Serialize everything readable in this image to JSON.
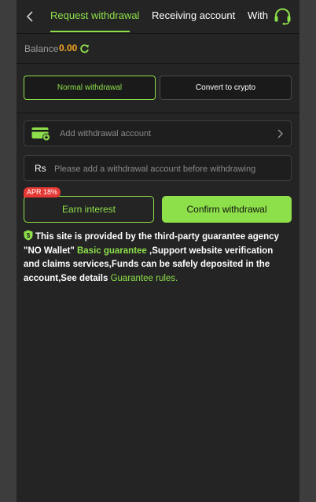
{
  "header": {
    "tabs": [
      {
        "label": "Request withdrawal",
        "active": true
      },
      {
        "label": "Receiving account",
        "active": false
      },
      {
        "label": "With",
        "active": false
      }
    ],
    "icons": {
      "back": "chevron-left-icon",
      "support": "headset-icon"
    }
  },
  "balance": {
    "label": "Balance",
    "value": "0.00",
    "icon": "refresh-icon"
  },
  "methods": {
    "normal": "Normal withdrawal",
    "crypto": "Convert to crypto"
  },
  "account": {
    "label": "Add withdrawal account",
    "icon": "card-add-icon"
  },
  "amount": {
    "currency": "Rs",
    "placeholder": "Please add a withdrawal account before withdrawing"
  },
  "actions": {
    "apr_badge": "APR 18%",
    "earn": "Earn interest",
    "confirm": "Confirm withdrawal"
  },
  "notice": {
    "text_1": "This site is provided by the third-party guarantee agency \"NO Wallet\" ",
    "highlight": "Basic guarantee",
    "text_2": " ,Support website verification and claims services,Funds can be safely deposited in the account,See details ",
    "link": "Guarantee rules."
  },
  "colors": {
    "accent": "#8ee04a",
    "balance": "#f5a623",
    "badge": "#e53935",
    "panel": "#242424",
    "backdrop": "#3d3d3d"
  }
}
